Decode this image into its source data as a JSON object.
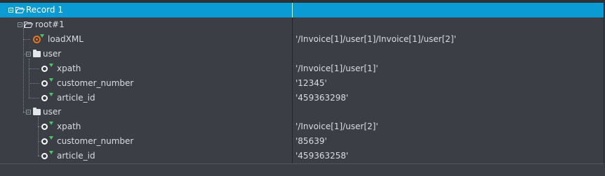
{
  "tree": {
    "record": {
      "label": "Record 1"
    },
    "root": {
      "label": "root#1"
    },
    "loadxml": {
      "label": "loadXML",
      "value": "'/Invoice[1]/user[1]/Invoice[1]/user[2]'"
    },
    "users": [
      {
        "label": "user",
        "fields": [
          {
            "name": "xpath",
            "value": "'/Invoice[1]/user[1]'"
          },
          {
            "name": "customer_number",
            "value": "'12345'"
          },
          {
            "name": "article_id",
            "value": "'459363298'"
          }
        ]
      },
      {
        "label": "user",
        "fields": [
          {
            "name": "xpath",
            "value": "'/Invoice[1]/user[2]'"
          },
          {
            "name": "customer_number",
            "value": "'85639'"
          },
          {
            "name": "article_id",
            "value": "'459363258'"
          }
        ]
      }
    ]
  },
  "colors": {
    "selection": "#0a9ad4",
    "background": "#3b3f45",
    "attribute_marker": "#4ac76b",
    "loadxml_icon": "#e8731e"
  },
  "icons": {
    "record": "folder-open-icon",
    "root": "folder-open-icon",
    "user": "folder-icon",
    "field": "attribute-icon",
    "loadxml": "load-xml-icon"
  }
}
